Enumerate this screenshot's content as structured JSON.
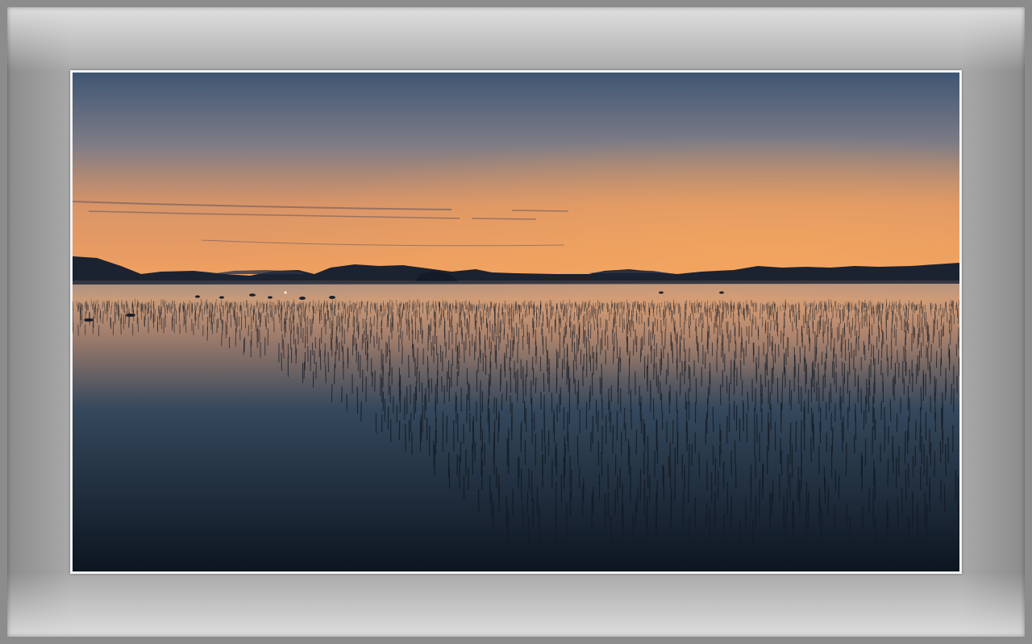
{
  "scene": {
    "subject": "sunset-over-tidal-flat",
    "colors": {
      "sky_top": "#3f5573",
      "sky_mid": "#8c7f7a",
      "sky_glow": "#f0a060",
      "horizon": "#d9884e",
      "mountains": "#1b2230",
      "water_top": "#c99a78",
      "water_mid": "#35485c",
      "water_bottom": "#0c1520",
      "frame_mat": "#a9a9a9",
      "frame_outer": "#8c8c8c"
    }
  }
}
